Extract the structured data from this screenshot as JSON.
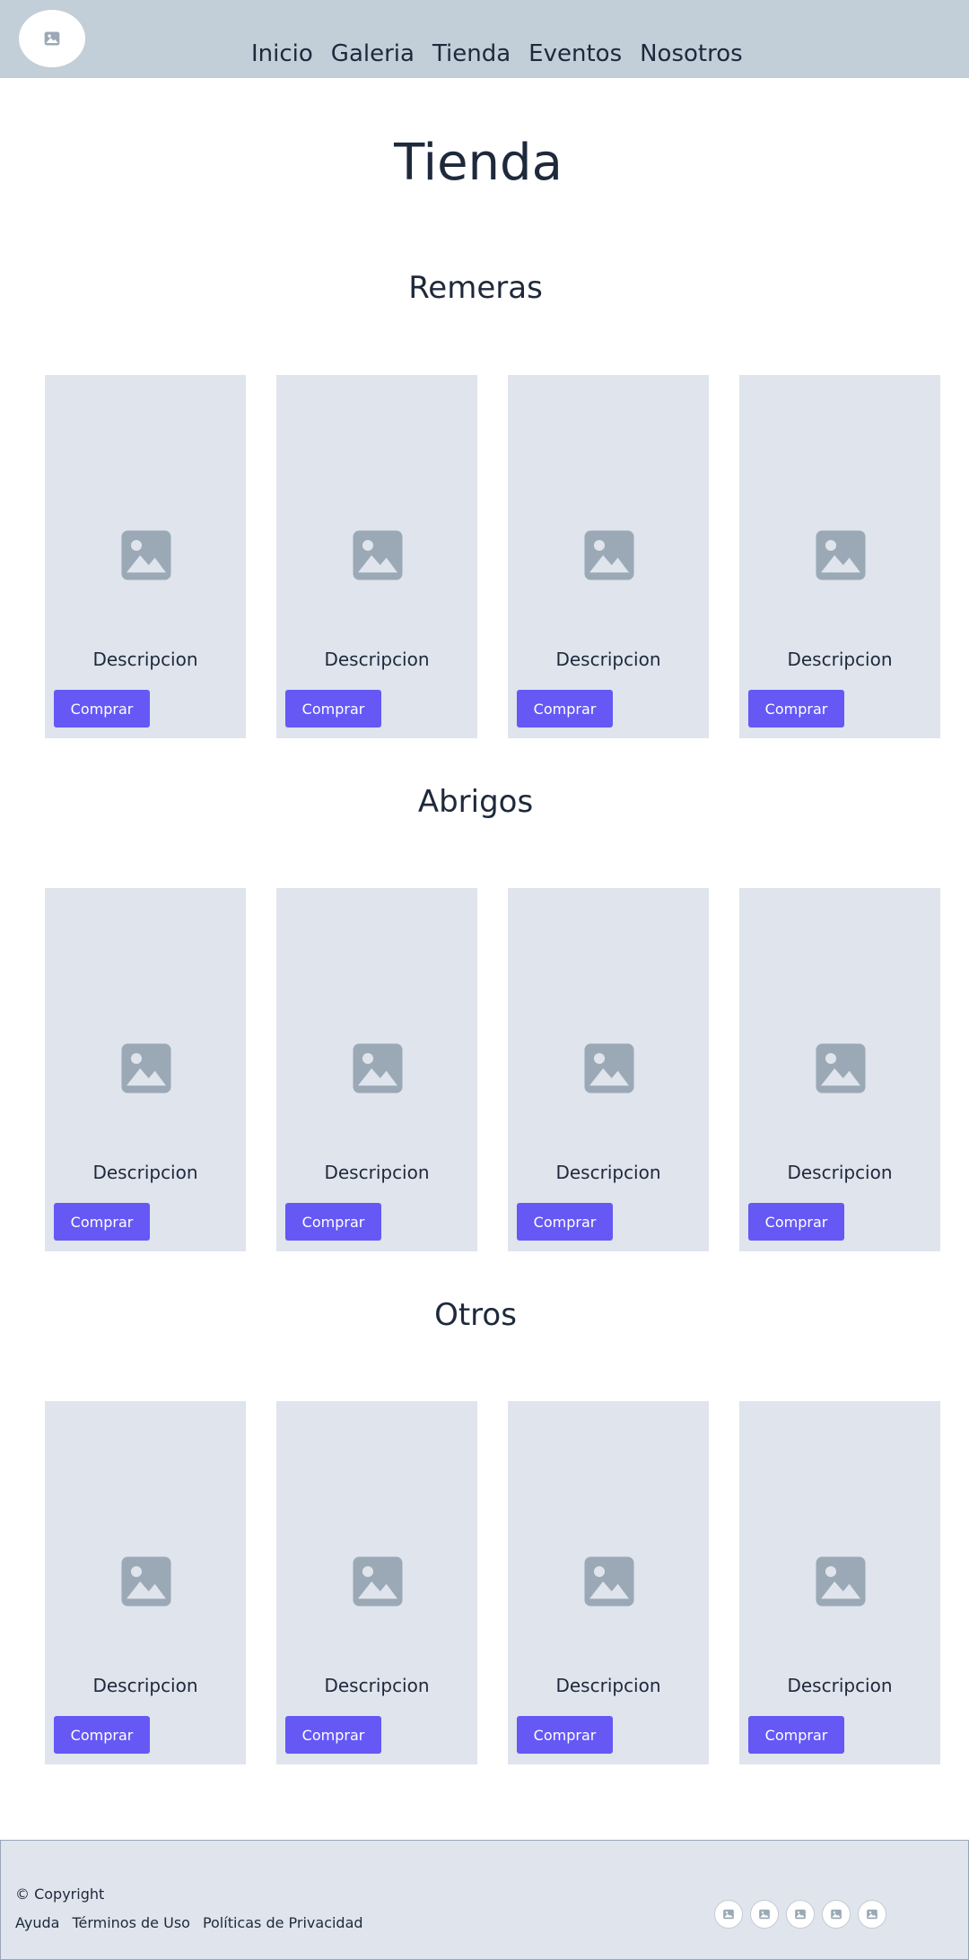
{
  "header": {
    "logo_icon": "image-icon",
    "nav": [
      "Inicio",
      "Galeria",
      "Tienda",
      "Eventos",
      "Nosotros"
    ]
  },
  "page_title": "Tienda",
  "sections": [
    {
      "title": "Remeras",
      "products": [
        {
          "description": "Descripcion",
          "button": "Comprar"
        },
        {
          "description": "Descripcion",
          "button": "Comprar"
        },
        {
          "description": "Descripcion",
          "button": "Comprar"
        },
        {
          "description": "Descripcion",
          "button": "Comprar"
        }
      ]
    },
    {
      "title": "Abrigos",
      "products": [
        {
          "description": "Descripcion",
          "button": "Comprar"
        },
        {
          "description": "Descripcion",
          "button": "Comprar"
        },
        {
          "description": "Descripcion",
          "button": "Comprar"
        },
        {
          "description": "Descripcion",
          "button": "Comprar"
        }
      ]
    },
    {
      "title": "Otros",
      "products": [
        {
          "description": "Descripcion",
          "button": "Comprar"
        },
        {
          "description": "Descripcion",
          "button": "Comprar"
        },
        {
          "description": "Descripcion",
          "button": "Comprar"
        },
        {
          "description": "Descripcion",
          "button": "Comprar"
        }
      ]
    }
  ],
  "footer": {
    "copyright": "© Copyright",
    "links": [
      "Ayuda",
      "Términos de Uso",
      "Políticas de Privacidad"
    ],
    "social_icons": [
      "image-icon",
      "image-icon",
      "image-icon",
      "image-icon",
      "image-icon"
    ]
  },
  "colors": {
    "header_bg": "#c2ced8",
    "card_bg": "#dfe4ed",
    "button_bg": "#6558f5",
    "placeholder_icon": "#9aa9b5",
    "text": "#1e293b"
  }
}
